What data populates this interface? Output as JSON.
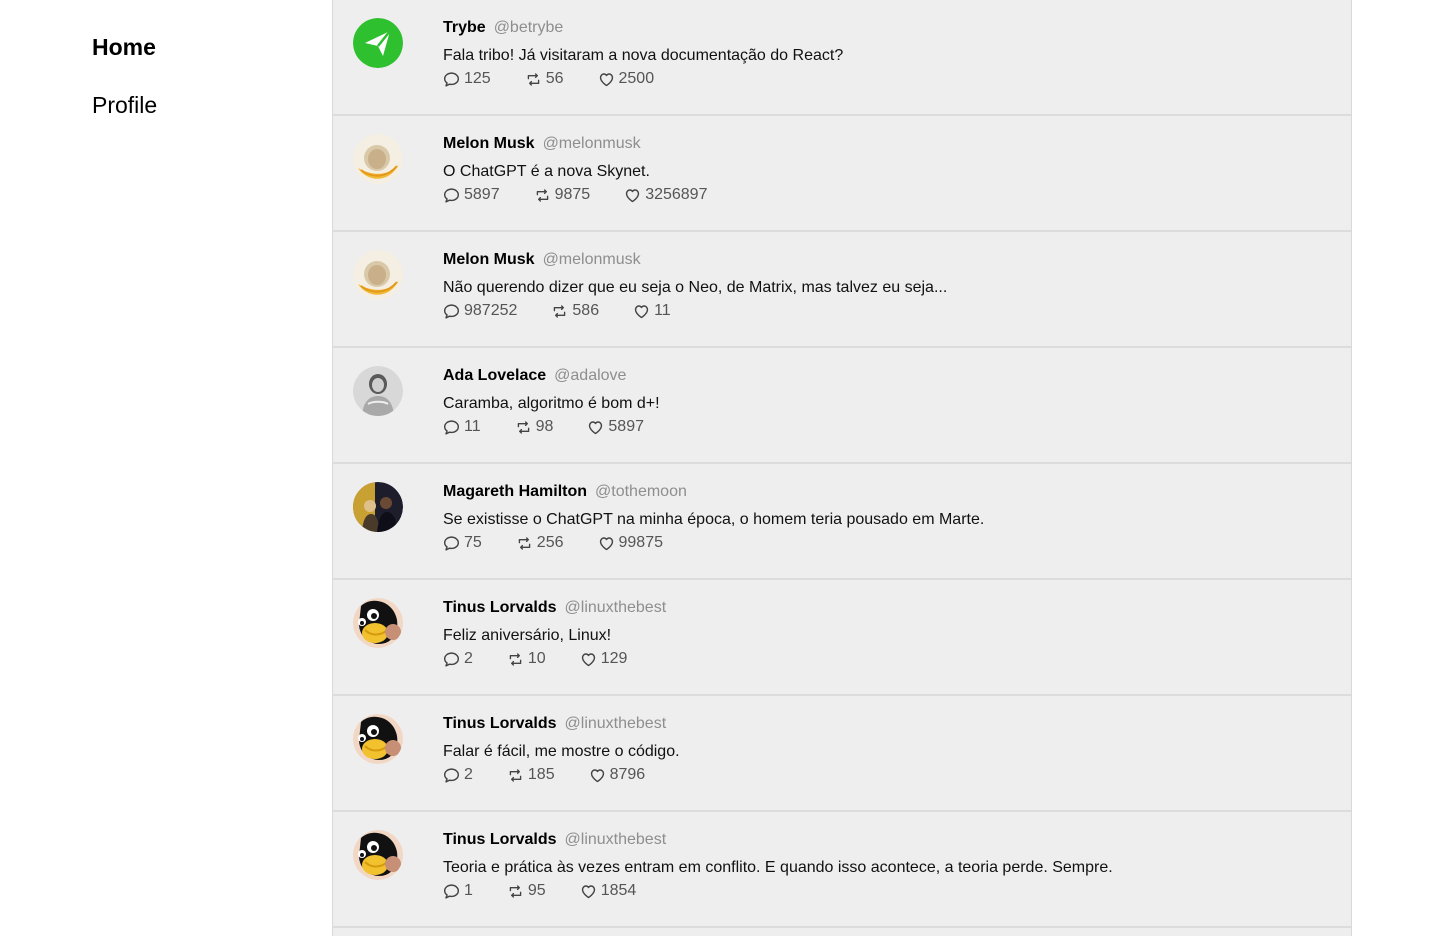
{
  "nav": {
    "home_label": "Home",
    "profile_label": "Profile"
  },
  "colors": {
    "trybe_green": "#2fc02f",
    "feed_background": "#eeeeee",
    "handle_gray": "#8e8e8e"
  },
  "tweets": [
    {
      "avatar": "trybe-logo",
      "name": "Trybe",
      "handle": "@betrybe",
      "text": "Fala tribo! Já visitaram a nova documentação do React?",
      "replies": "125",
      "retweets": "56",
      "likes": "2500"
    },
    {
      "avatar": "melon-musk",
      "name": "Melon Musk",
      "handle": "@melonmusk",
      "text": "O ChatGPT é a nova Skynet.",
      "replies": "5897",
      "retweets": "9875",
      "likes": "3256897"
    },
    {
      "avatar": "melon-musk",
      "name": "Melon Musk",
      "handle": "@melonmusk",
      "text": "Não querendo dizer que eu seja o Neo, de Matrix, mas talvez eu seja...",
      "replies": "987252",
      "retweets": "586",
      "likes": "11"
    },
    {
      "avatar": "ada-lovelace",
      "name": "Ada Lovelace",
      "handle": "@adalove",
      "text": "Caramba, algoritmo é bom d+!",
      "replies": "11",
      "retweets": "98",
      "likes": "5897"
    },
    {
      "avatar": "magareth-hamilton",
      "name": "Magareth Hamilton",
      "handle": "@tothemoon",
      "text": "Se existisse o ChatGPT na minha época, o homem teria pousado em Marte.",
      "replies": "75",
      "retweets": "256",
      "likes": "99875"
    },
    {
      "avatar": "tinus-lorvalds",
      "name": "Tinus Lorvalds",
      "handle": "@linuxthebest",
      "text": "Feliz aniversário, Linux!",
      "replies": "2",
      "retweets": "10",
      "likes": "129"
    },
    {
      "avatar": "tinus-lorvalds",
      "name": "Tinus Lorvalds",
      "handle": "@linuxthebest",
      "text": "Falar é fácil, me mostre o código.",
      "replies": "2",
      "retweets": "185",
      "likes": "8796"
    },
    {
      "avatar": "tinus-lorvalds",
      "name": "Tinus Lorvalds",
      "handle": "@linuxthebest",
      "text": "Teoria e prática às vezes entram em conflito. E quando isso acontece, a teoria perde. Sempre.",
      "replies": "1",
      "retweets": "95",
      "likes": "1854"
    }
  ]
}
